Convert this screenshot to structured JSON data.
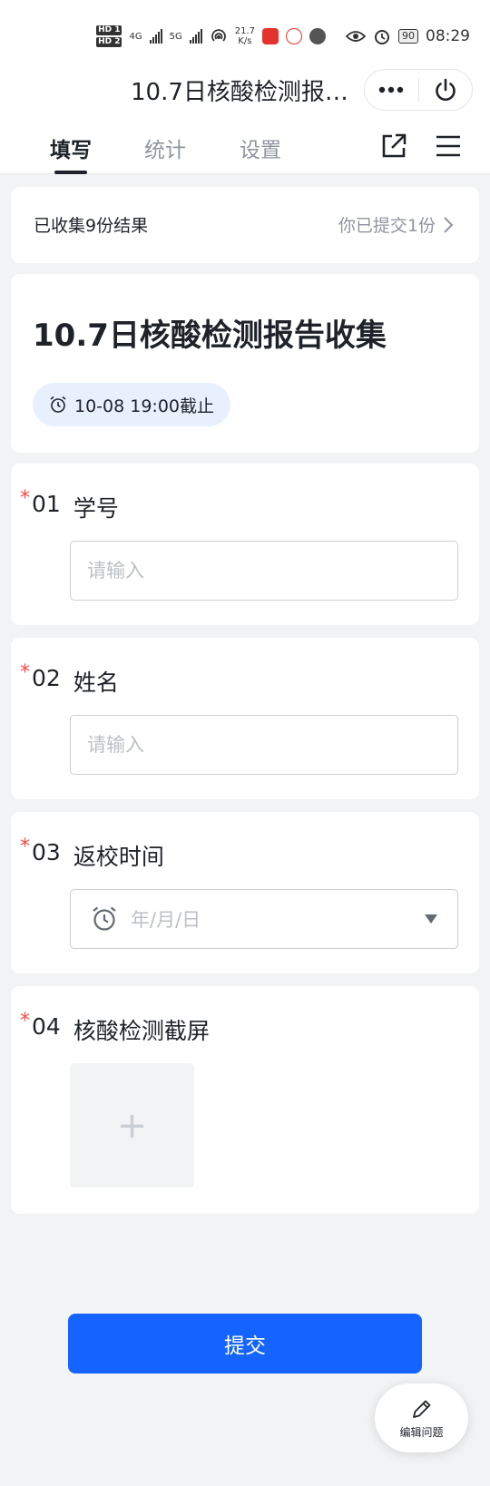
{
  "status_bar": {
    "hd1": "HD 1",
    "hd2": "HD 2",
    "net1": "4G",
    "net2": "5G",
    "speed_value": "21.7",
    "speed_unit": "K/s",
    "battery": "90",
    "time": "08:29"
  },
  "title_bar": {
    "title": "10.7日核酸检测报告收集"
  },
  "tabs": [
    {
      "label": "填写",
      "active": true
    },
    {
      "label": "统计",
      "active": false
    },
    {
      "label": "设置",
      "active": false
    }
  ],
  "summary": {
    "collected": "已收集9份结果",
    "submitted": "你已提交1份"
  },
  "form": {
    "title": "10.7日核酸检测报告收集",
    "deadline": "10-08 19:00截止"
  },
  "questions": [
    {
      "num": "01",
      "label": "学号",
      "placeholder": "请输入",
      "required": "*"
    },
    {
      "num": "02",
      "label": "姓名",
      "placeholder": "请输入",
      "required": "*"
    },
    {
      "num": "03",
      "label": "返校时间",
      "placeholder": "年/月/日",
      "required": "*"
    },
    {
      "num": "04",
      "label": "核酸检测截屏",
      "upload_symbol": "+",
      "required": "*"
    }
  ],
  "submit_label": "提交",
  "edit_label": "编辑问题",
  "colors": {
    "primary": "#1664ff",
    "required": "#f54a45",
    "chip_bg": "#e8f0fe",
    "page_bg": "#f2f3f5"
  },
  "icons": [
    "more-icon",
    "power-icon",
    "share-icon",
    "menu-icon",
    "chevron-right-icon",
    "alarm-clock-icon",
    "dropdown-arrow-icon",
    "pencil-icon"
  ]
}
